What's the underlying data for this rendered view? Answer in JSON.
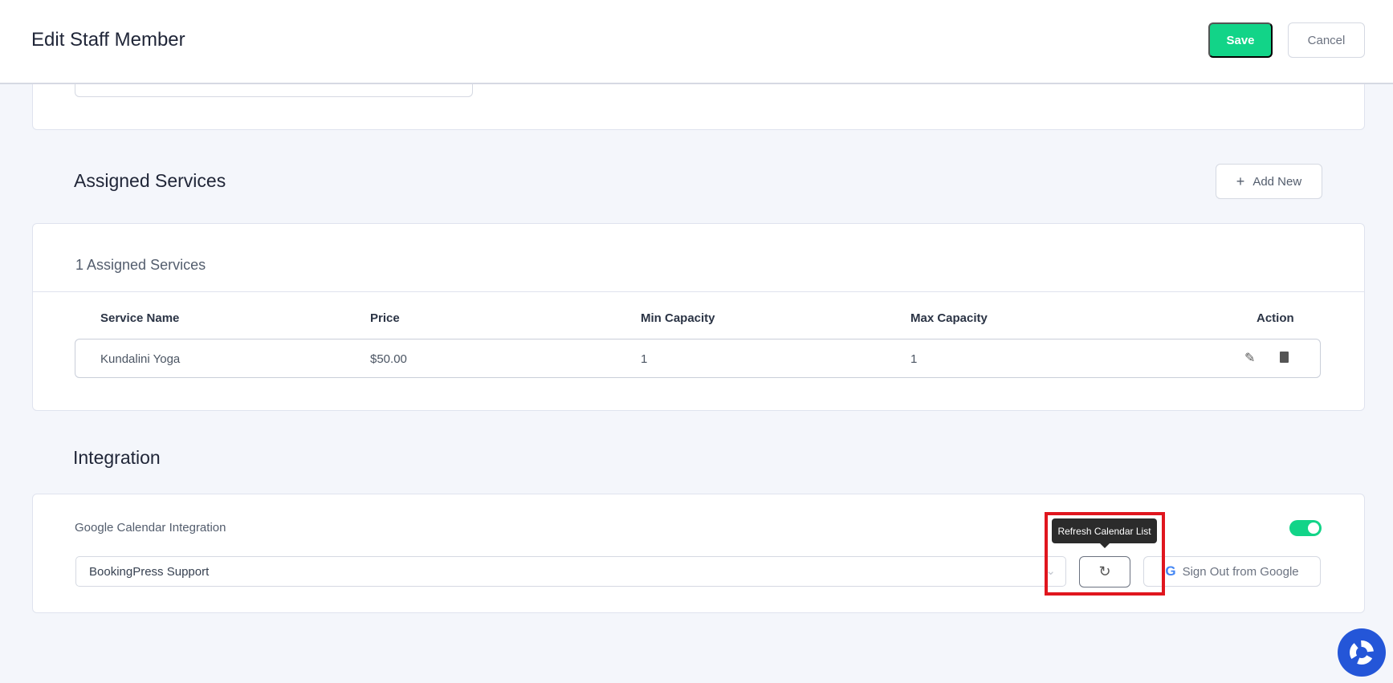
{
  "header": {
    "title": "Edit Staff Member",
    "save_label": "Save",
    "cancel_label": "Cancel"
  },
  "services": {
    "heading": "Assigned Services",
    "add_new_label": "Add New",
    "count_label": "1 Assigned Services",
    "columns": [
      "Service Name",
      "Price",
      "Min Capacity",
      "Max Capacity",
      "Action"
    ],
    "rows": [
      {
        "name": "Kundalini Yoga",
        "price": "$50.00",
        "min": "1",
        "max": "1"
      }
    ]
  },
  "integration": {
    "heading": "Integration",
    "google_label": "Google Calendar Integration",
    "enabled": true,
    "calendar_value": "BookingPress Support",
    "tooltip": "Refresh Calendar List",
    "sign_out_label": "Sign Out from Google"
  },
  "colors": {
    "accent": "#12d488",
    "highlight": "#e0161e",
    "help": "#2456d8"
  }
}
